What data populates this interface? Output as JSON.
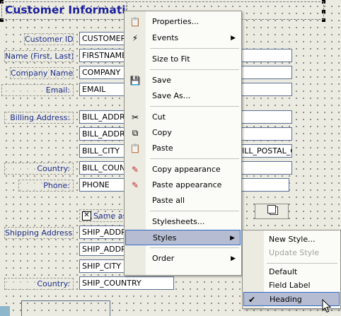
{
  "form": {
    "heading": "Customer Information",
    "labels": {
      "customer_id": "Customer ID:",
      "name": "Name (First, Last):",
      "company": "Company Name:",
      "email": "Email:",
      "billing": "Billing Address:",
      "country1": "Country:",
      "phone": "Phone:",
      "same_as": "Same as",
      "shipping": "Shipping Address:",
      "country2": "Country:"
    },
    "fields": {
      "customer_id": "CUSTOMER_",
      "firstname": "FIRSTNAME",
      "company": "COMPANY",
      "email": "EMAIL",
      "bill_addr1": "BILL_ADDRE",
      "bill_addr2": "BILL_ADDRE",
      "bill_city": "BILL_CITY",
      "bill_postal": "ILL_POSTAL_C",
      "bill_country": "BILL_COUNTR",
      "phone": "PHONE",
      "ship_addr1": "SHIP_ADDRE",
      "ship_addr2": "SHIP_ADDRE",
      "ship_city": "SHIP_CITY",
      "ship_country": "SHIP_COUNTRY"
    },
    "same_as_checked": true
  },
  "context_menu": {
    "items": [
      {
        "label": "Properties...",
        "icon": "properties-icon"
      },
      {
        "label": "Events",
        "icon": "events-icon",
        "submenu": true
      },
      {
        "label": "Size to Fit"
      },
      {
        "label": "Save",
        "icon": "save-icon"
      },
      {
        "label": "Save As..."
      },
      {
        "label": "Cut",
        "icon": "cut-icon"
      },
      {
        "label": "Copy",
        "icon": "copy-icon"
      },
      {
        "label": "Paste",
        "icon": "paste-icon"
      },
      {
        "label": "Copy appearance",
        "icon": "copy-appearance-icon"
      },
      {
        "label": "Paste appearance",
        "icon": "paste-appearance-icon"
      },
      {
        "label": "Paste all"
      },
      {
        "label": "Stylesheets..."
      },
      {
        "label": "Styles",
        "submenu": true,
        "highlighted": true
      },
      {
        "label": "Order",
        "submenu": true
      }
    ]
  },
  "styles_submenu": {
    "items": [
      {
        "label": "New Style...",
        "disabled": false
      },
      {
        "label": "Update Style",
        "disabled": true
      },
      {
        "label": "Default"
      },
      {
        "label": "Field Label"
      },
      {
        "label": "Heading",
        "checked": true,
        "highlighted": true
      }
    ]
  },
  "colors": {
    "accent": "#316ac5",
    "highlight": "#b6bdd2",
    "heading_text": "#1a1f9e",
    "label_text": "#1c2d8c"
  }
}
